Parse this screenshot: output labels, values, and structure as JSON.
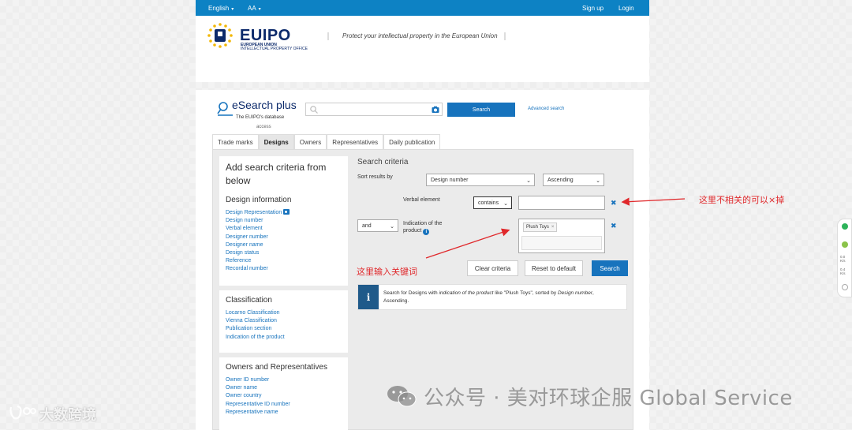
{
  "topbar": {
    "language": "English",
    "font_size": "AA",
    "sign_up": "Sign up",
    "login": "Login"
  },
  "header": {
    "logo_text": "EUIPO",
    "logo_sub1": "EUROPEAN UNION",
    "logo_sub2": "INTELLECTUAL PROPERTY OFFICE",
    "tagline": "Protect your intellectual property in the European Union"
  },
  "esearch": {
    "title": "eSearch plus",
    "subtitle": "The EUIPO's database",
    "subtitle2": "access",
    "search_placeholder": "",
    "search_button": "Search",
    "advanced_search": "Advanced search"
  },
  "tabs": [
    {
      "label": "Trade marks",
      "active": false
    },
    {
      "label": "Designs",
      "active": true
    },
    {
      "label": "Owners",
      "active": false
    },
    {
      "label": "Representatives",
      "active": false
    },
    {
      "label": "Daily publication",
      "active": false
    }
  ],
  "left": {
    "heading": "Add search criteria from below",
    "design_info": {
      "title": "Design information",
      "links": [
        "Design Representation",
        "Design number",
        "Verbal element",
        "Designer number",
        "Designer name",
        "Design status",
        "Reference",
        "Recordal number"
      ]
    },
    "classification": {
      "title": "Classification",
      "links": [
        "Locarno Classification",
        "Vienna Classification",
        "Publication section",
        "Indication of the product"
      ]
    },
    "owners": {
      "title": "Owners and Representatives",
      "links": [
        "Owner ID number",
        "Owner name",
        "Owner country",
        "Representative ID number",
        "Representative name"
      ]
    }
  },
  "criteria": {
    "title": "Search criteria",
    "sort_label": "Sort results by",
    "sort_field": "Design number",
    "sort_order": "Ascending",
    "verbal_label": "Verbal element",
    "verbal_operator": "contains",
    "verbal_value": "",
    "logic_operator": "and",
    "indication_label": "Indication of the product",
    "indication_chip": "Plush Toys",
    "chip_remove": "×",
    "remove_icon": "✖",
    "clear_button": "Clear criteria",
    "reset_button": "Reset to default",
    "search_button": "Search",
    "summary_pre": "Search for Designs with ",
    "summary_em1": "indication of the product",
    "summary_mid": " like \"Plush Toys\", sorted by ",
    "summary_em2": "Design number",
    "summary_post": ", Ascending."
  },
  "annotations": {
    "remove_note": "这里不相关的可以×掉",
    "keyword_note": "这里输入关键词"
  },
  "watermark": {
    "right": "公众号 · 美对环球企服 Global Service",
    "left": "大数跨境"
  },
  "sidewidget": {
    "val1": "0.0",
    "unit1": "K/s",
    "val2": "0.4",
    "unit2": "K/s"
  },
  "colors": {
    "topbar": "#0d82c4",
    "button": "#1773bd",
    "link": "#1773bd",
    "logo_navy": "#0c2a6b",
    "annotation": "#e0282b",
    "info_box": "#1f5a8a"
  }
}
